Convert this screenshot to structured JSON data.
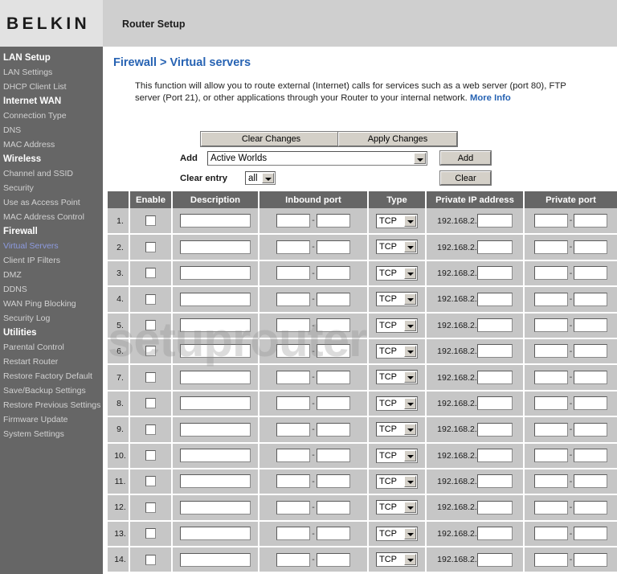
{
  "header": {
    "brand": "BELKIN",
    "title": "Router Setup"
  },
  "sidebar": {
    "groups": [
      {
        "heading": "LAN Setup",
        "items": [
          "LAN Settings",
          "DHCP Client List"
        ]
      },
      {
        "heading": "Internet WAN",
        "items": [
          "Connection Type",
          "DNS",
          "MAC Address"
        ]
      },
      {
        "heading": "Wireless",
        "items": [
          "Channel and SSID",
          "Security",
          "Use as Access Point",
          "MAC Address Control"
        ]
      },
      {
        "heading": "Firewall",
        "items": [
          "Virtual Servers",
          "Client IP Filters",
          "DMZ",
          "DDNS",
          "WAN Ping Blocking",
          "Security Log"
        ]
      },
      {
        "heading": "Utilities",
        "items": [
          "Parental Control",
          "Restart Router",
          "Restore Factory Default",
          "Save/Backup Settings",
          "Restore Previous Settings",
          "Firmware Update",
          "System Settings"
        ]
      }
    ],
    "active_item": "Virtual Servers"
  },
  "main": {
    "page_title": "Firewall > Virtual servers",
    "description": "This function will allow you to route external (Internet) calls for services such as a web server (port 80), FTP server (Port 21), or other applications through your Router to your internal network.",
    "more_info_label": "More Info",
    "watermark": "setuprouter"
  },
  "toolbar": {
    "clear_changes_label": "Clear Changes",
    "apply_changes_label": "Apply Changes",
    "add_label": "Add",
    "add_button_label": "Add",
    "clear_entry_label": "Clear entry",
    "clear_button_label": "Clear",
    "add_service_value": "Active Worlds",
    "clear_entry_value": "all"
  },
  "table": {
    "columns": [
      "",
      "Enable",
      "Description",
      "Inbound port",
      "Type",
      "Private IP address",
      "Private port"
    ],
    "ip_prefix": "192.168.2.",
    "default_type": "TCP",
    "rows": [
      {
        "num": "1.",
        "enabled": false,
        "description": "",
        "inbound_from": "",
        "inbound_to": "",
        "type": "TCP",
        "private_ip": "",
        "private_from": "",
        "private_to": ""
      },
      {
        "num": "2.",
        "enabled": false,
        "description": "",
        "inbound_from": "",
        "inbound_to": "",
        "type": "TCP",
        "private_ip": "",
        "private_from": "",
        "private_to": ""
      },
      {
        "num": "3.",
        "enabled": false,
        "description": "",
        "inbound_from": "",
        "inbound_to": "",
        "type": "TCP",
        "private_ip": "",
        "private_from": "",
        "private_to": ""
      },
      {
        "num": "4.",
        "enabled": false,
        "description": "",
        "inbound_from": "",
        "inbound_to": "",
        "type": "TCP",
        "private_ip": "",
        "private_from": "",
        "private_to": ""
      },
      {
        "num": "5.",
        "enabled": false,
        "description": "",
        "inbound_from": "",
        "inbound_to": "",
        "type": "TCP",
        "private_ip": "",
        "private_from": "",
        "private_to": ""
      },
      {
        "num": "6.",
        "enabled": false,
        "description": "",
        "inbound_from": "",
        "inbound_to": "",
        "type": "TCP",
        "private_ip": "",
        "private_from": "",
        "private_to": ""
      },
      {
        "num": "7.",
        "enabled": false,
        "description": "",
        "inbound_from": "",
        "inbound_to": "",
        "type": "TCP",
        "private_ip": "",
        "private_from": "",
        "private_to": ""
      },
      {
        "num": "8.",
        "enabled": false,
        "description": "",
        "inbound_from": "",
        "inbound_to": "",
        "type": "TCP",
        "private_ip": "",
        "private_from": "",
        "private_to": ""
      },
      {
        "num": "9.",
        "enabled": false,
        "description": "",
        "inbound_from": "",
        "inbound_to": "",
        "type": "TCP",
        "private_ip": "",
        "private_from": "",
        "private_to": ""
      },
      {
        "num": "10.",
        "enabled": false,
        "description": "",
        "inbound_from": "",
        "inbound_to": "",
        "type": "TCP",
        "private_ip": "",
        "private_from": "",
        "private_to": ""
      },
      {
        "num": "11.",
        "enabled": false,
        "description": "",
        "inbound_from": "",
        "inbound_to": "",
        "type": "TCP",
        "private_ip": "",
        "private_from": "",
        "private_to": ""
      },
      {
        "num": "12.",
        "enabled": false,
        "description": "",
        "inbound_from": "",
        "inbound_to": "",
        "type": "TCP",
        "private_ip": "",
        "private_from": "",
        "private_to": ""
      },
      {
        "num": "13.",
        "enabled": false,
        "description": "",
        "inbound_from": "",
        "inbound_to": "",
        "type": "TCP",
        "private_ip": "",
        "private_from": "",
        "private_to": ""
      },
      {
        "num": "14.",
        "enabled": false,
        "description": "",
        "inbound_from": "",
        "inbound_to": "",
        "type": "TCP",
        "private_ip": "",
        "private_from": "",
        "private_to": ""
      }
    ]
  },
  "colors": {
    "header_bg": "#cfcfcf",
    "logo_bg": "#e2e2e2",
    "sidebar_bg": "#666666",
    "accent_blue": "#2763b3",
    "active_nav": "#8d9be0",
    "table_row_bg": "#c6c6c6"
  }
}
